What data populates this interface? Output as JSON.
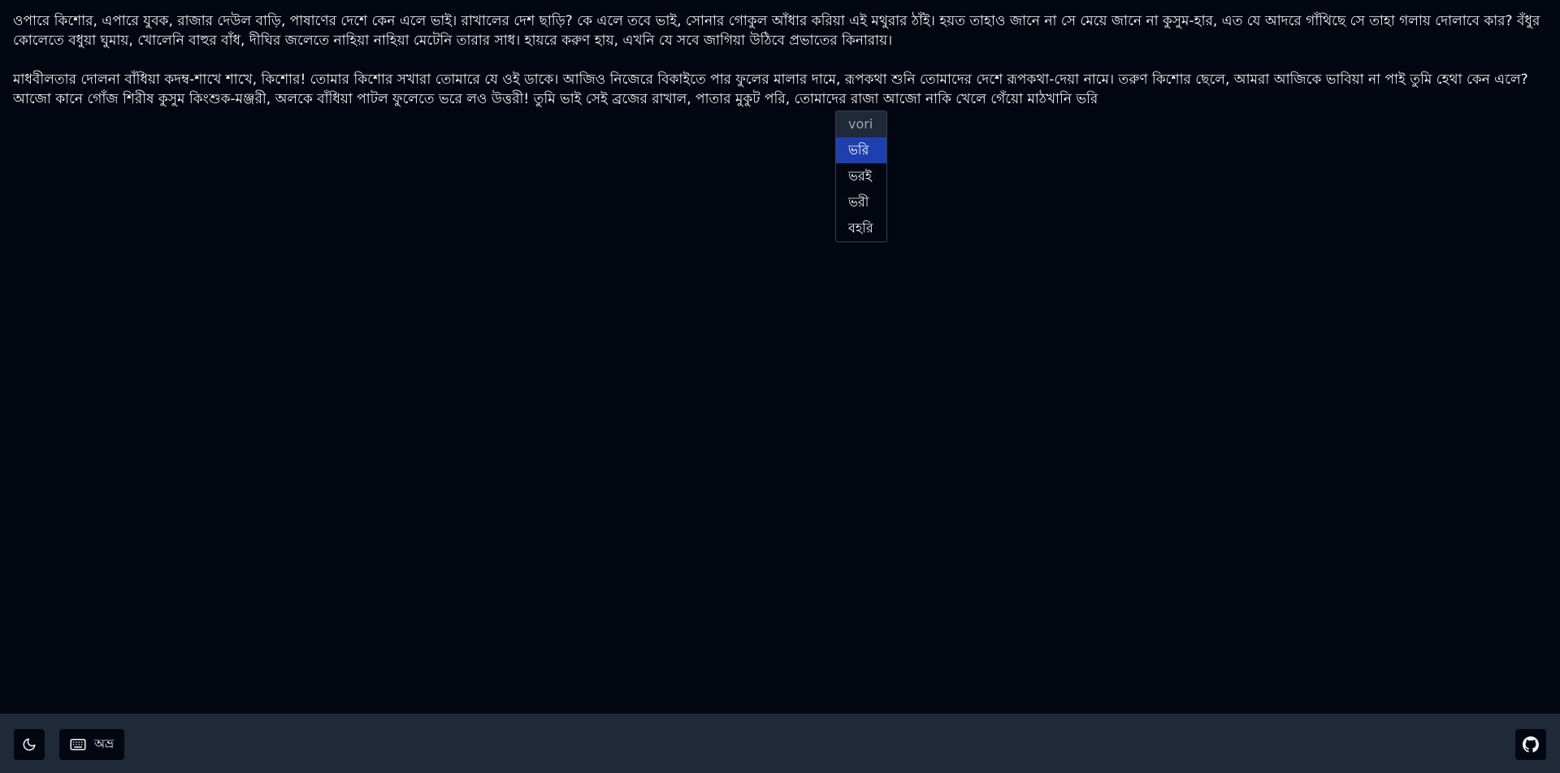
{
  "editor": {
    "paragraphs": [
      "ওপারে কিশোর, এপারে যুবক, রাজার দেউল বাড়ি, পাষাণের দেশে কেন এলে ভাই। রাখালের দেশ ছাড়ি? কে এলে তবে ভাই, সোনার গোকুল আঁধার করিয়া এই মথুরার ঠাঁই। হয়ত তাহাও জানে না সে মেয়ে জানে না কুসুম-হার, এত যে আদরে গাঁথিছে সে তাহা গলায় দোলাবে কার? বঁধুর কোলেতে বধুয়া ঘুমায়, খোলেনি বাহুর বাঁধ, দীঘির জলেতে নাহিয়া নাহিয়া মেটেনি তারার সাধ। হায়রে করুণ হায়, এখনি যে সবে জাগিয়া উঠিবে প্রভাতের কিনারায়।",
      "মাধবীলতার দোলনা বাঁধিয়া কদম্ব-শাখে শাখে, কিশোর! তোমার কিশোর সখারা তোমারে যে ওই ডাকে। আজিও নিজেরে বিকাইতে পার ফুলের মালার দামে, রূপকথা শুনি তোমাদের দেশে রূপকথা-দেয়া নামে। তরুণ কিশোর ছেলে, আমরা আজিকে ভাবিয়া না পাই তুমি হেথা কেন এলে? আজো কানে গোঁজ শিরীষ কুসুম কিংশুক-মঞ্জরী, অলকে বাঁধিয়া পাটল ফুলেতে ভরে লও উত্তরী! তুমি ভাই সেই ব্রজের রাখাল, পাতার মুকুট পরি, তোমাদের রাজা আজো নাকি খেলে গেঁয়ো মাঠখানি ভরি"
    ]
  },
  "suggestions": {
    "typed": "vori",
    "options": [
      "ভরি",
      "ভরই",
      "ভরী",
      "বহরি"
    ],
    "selected_index": 0
  },
  "footer": {
    "theme_icon": "moon-icon",
    "keyboard_icon": "keyboard-icon",
    "keyboard_label": "অভ্র",
    "github_icon": "github-icon"
  }
}
